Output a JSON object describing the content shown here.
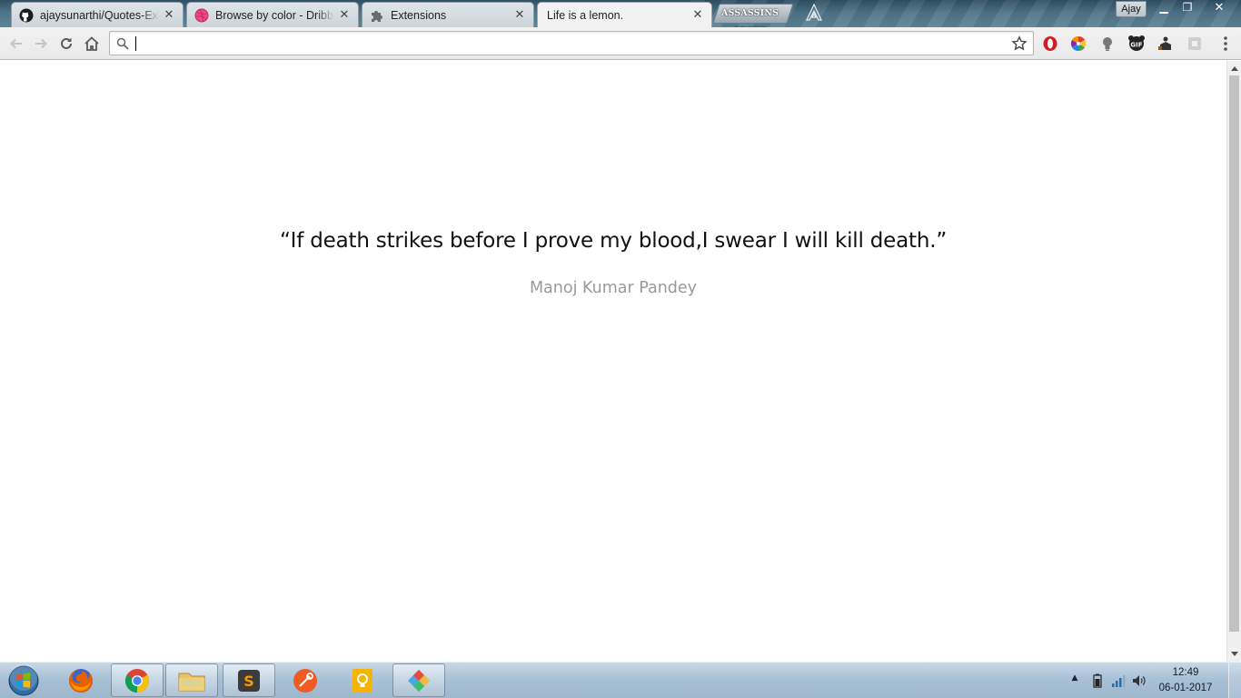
{
  "browser": {
    "tabs": [
      {
        "title": "ajaysunarthi/Quotes-Exte",
        "favicon": "github-icon"
      },
      {
        "title": "Browse by color - Dribbb",
        "favicon": "dribbble-icon"
      },
      {
        "title": "Extensions",
        "favicon": "puzzle-icon"
      },
      {
        "title": "Life is a lemon.",
        "favicon": "none",
        "active": true
      }
    ],
    "tab_close_glyph": "✕",
    "theme_logo_text": "ASSASSINS CREED",
    "profile_name": "Ajay",
    "window_controls": {
      "minimize": "▁",
      "maximize": "❐",
      "close": "✕"
    },
    "omnibox": {
      "value": "",
      "placeholder": ""
    },
    "extensions": [
      "opera-icon",
      "color-wheel-icon",
      "lightbulb-icon",
      "gif-icon",
      "figure-icon",
      "puzzle-gray-icon"
    ]
  },
  "page": {
    "quote": "“If death strikes before I prove my blood,I swear I will kill death.”",
    "author": "Manoj Kumar Pandey"
  },
  "taskbar": {
    "apps": [
      "firefox-icon",
      "chrome-icon",
      "file-explorer-icon",
      "sublime-text-icon",
      "postman-icon",
      "keep-icon",
      "gitkraken-icon"
    ],
    "clock": {
      "time": "12:49",
      "date": "06-01-2017"
    }
  },
  "colors": {
    "quote_text": "#111111",
    "author_text": "#9a9a9a",
    "page_bg": "#ffffff"
  }
}
